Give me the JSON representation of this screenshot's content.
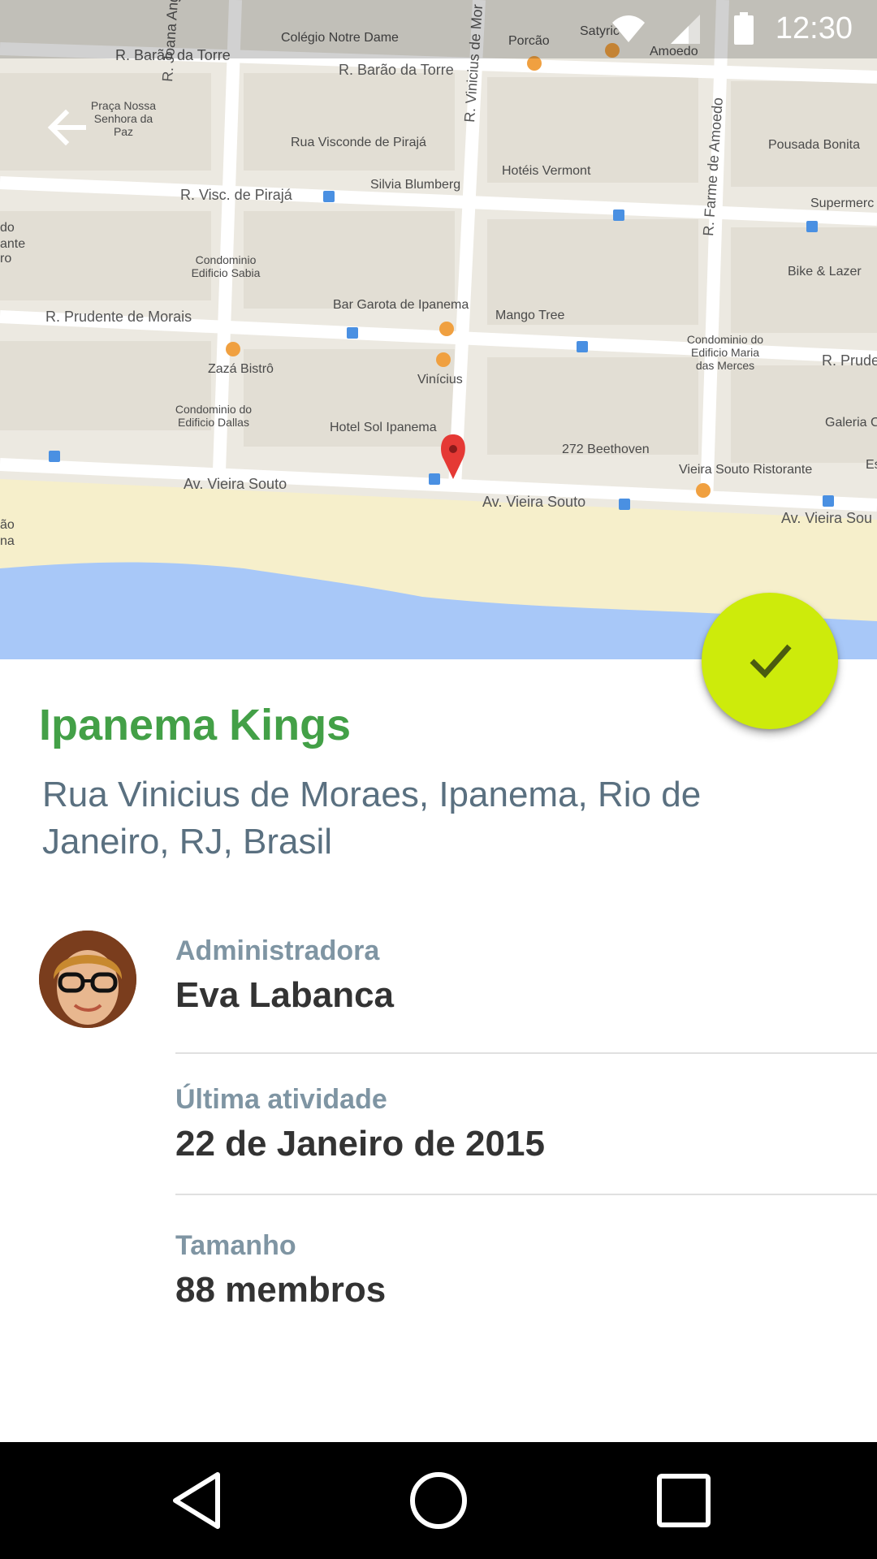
{
  "status_bar": {
    "time": "12:30"
  },
  "map": {
    "streets": [
      "R. Barão da Torre",
      "R. Barão da Torre",
      "R. Joana Angélica",
      "R. Vinicius de Mor",
      "R. Visc. de Pirajá",
      "R. Prudente de Morais",
      "R. Prude",
      "R. Farme de Amoedo",
      "Av. Vieira Souto",
      "Av. Vieira Souto",
      "Av. Vieira Sou"
    ],
    "places": [
      "Colégio Notre Dame",
      "Porcão",
      "Satyric",
      "Amoedo",
      "Praça Nossa Senhora da Paz",
      "Rua Visconde de Pirajá",
      "Silvia Blumberg",
      "Hotéis Vermont",
      "Pousada Bonita",
      "Supermerc",
      "Condominio Edificio Sabia",
      "Bike & Lazer",
      "Bar Garota de Ipanema",
      "Mango Tree",
      "Condominio do Edificio Maria das Merces",
      "Zazá Bistrô",
      "Vinícius",
      "Condominio do Edificio Dallas",
      "Hotel Sol Ipanema",
      "272 Beethoven",
      "Galeria C",
      "Vieira Souto Ristorante",
      "Es",
      "ante",
      "do",
      "ro",
      "ão",
      "na"
    ]
  },
  "group": {
    "name": "Ipanema Kings",
    "address": "Rua Vinicius de Moraes, Ipanema, Rio de Janeiro, RJ, Brasil"
  },
  "details": [
    {
      "label": "Administradora",
      "value": "Eva Labanca"
    },
    {
      "label": "Última atividade",
      "value": "22 de Janeiro de 2015"
    },
    {
      "label": "Tamanho",
      "value": "88 membros"
    }
  ],
  "colors": {
    "title": "#43a047",
    "fab": "#cdeb0b",
    "address": "#5a7080",
    "label": "#7f95a3"
  },
  "icons": {
    "back": "arrow-left-icon",
    "fab": "check-icon",
    "map_pin": "map-pin-icon",
    "nav_back": "triangle-back-icon",
    "nav_home": "circle-home-icon",
    "nav_recents": "square-recents-icon"
  }
}
